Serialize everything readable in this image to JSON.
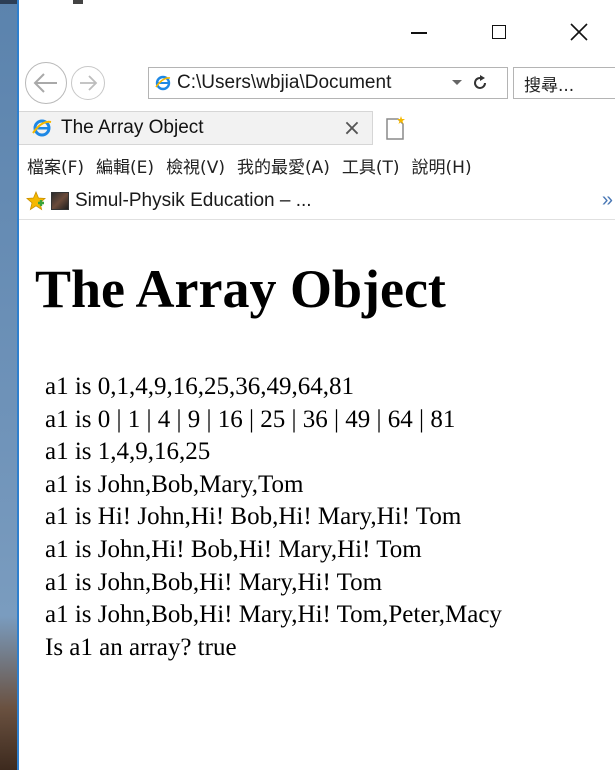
{
  "window": {
    "controls": {
      "minimize": "minimize",
      "maximize": "maximize",
      "close": "close"
    }
  },
  "address_bar": {
    "url": "C:\\Users\\wbjia\\Document",
    "search_placeholder": "搜尋..."
  },
  "tab": {
    "title": "The Array Object",
    "close_glyph": "×"
  },
  "menu": {
    "items": [
      "檔案(F)",
      "編輯(E)",
      "檢視(V)",
      "我的最愛(A)",
      "工具(T)",
      "說明(H)"
    ]
  },
  "favorites": {
    "item": "Simul-Physik Education – ...",
    "more_glyph": "»"
  },
  "page": {
    "heading": "The Array Object",
    "lines": [
      "a1 is 0,1,4,9,16,25,36,49,64,81",
      "a1 is 0 | 1 | 4 | 9 | 16 | 25 | 36 | 49 | 64 | 81",
      "a1 is 1,4,9,16,25",
      "a1 is John,Bob,Mary,Tom",
      "a1 is Hi! John,Hi! Bob,Hi! Mary,Hi! Tom",
      "a1 is John,Hi! Bob,Hi! Mary,Hi! Tom",
      "a1 is John,Bob,Hi! Mary,Hi! Tom",
      "a1 is John,Bob,Hi! Mary,Hi! Tom,Peter,Macy",
      "Is a1 an array? true"
    ]
  },
  "colors": {
    "window_border": "#2f7fcd",
    "ie_blue": "#1e88e5",
    "fav_star": "#f5b800"
  }
}
